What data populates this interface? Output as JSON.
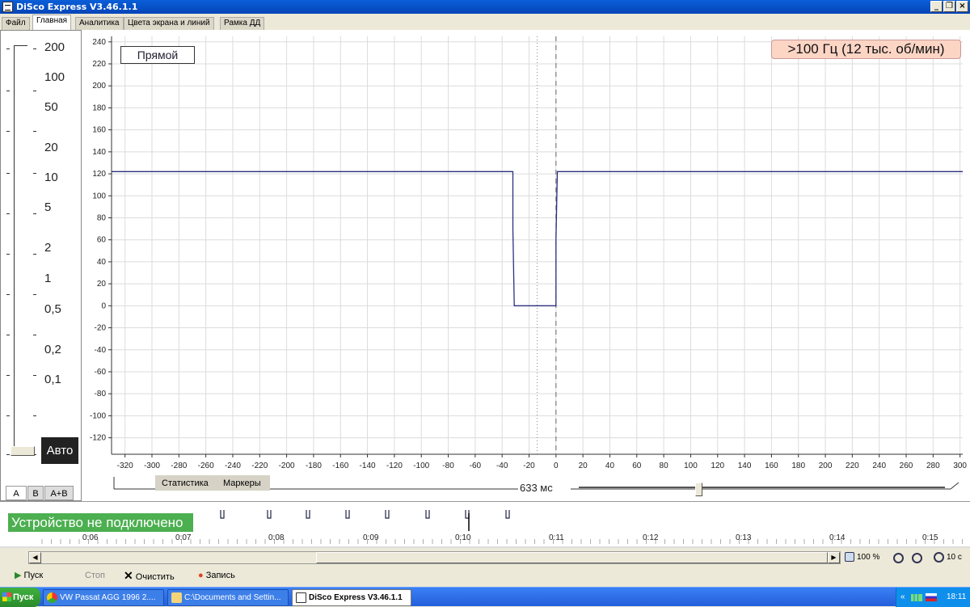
{
  "window": {
    "title": "DiSco Express V3.46.1.1",
    "controls": {
      "minimize": "_",
      "restore": "❐",
      "close": "×"
    }
  },
  "menu_tabs": [
    {
      "label": "Файл",
      "active": false
    },
    {
      "label": "Главная",
      "active": true
    },
    {
      "label": "Аналитика",
      "active": false
    },
    {
      "label": "Цвета экрана и линий",
      "active": false
    },
    {
      "label": "Рамка ДД",
      "active": false
    }
  ],
  "scale_panel": {
    "labels": [
      "200",
      "100",
      "50",
      "20",
      "10",
      "5",
      "2",
      "1",
      "0,5",
      "0,2",
      "0,1"
    ],
    "auto_button": "Авто",
    "channel_tabs": [
      "A",
      "B",
      "A+B"
    ]
  },
  "plot": {
    "mode_label": "Прямой",
    "frequency_label": ">100 Гц (12 тыс. об/мин)",
    "subtabs": [
      "Статистика",
      "Маркеры"
    ],
    "window_label": "633 мс"
  },
  "chart_data": {
    "type": "line",
    "xlim": [
      -330,
      302
    ],
    "ylim": [
      -135,
      245
    ],
    "x_ticks": [
      -320,
      -300,
      -280,
      -260,
      -240,
      -220,
      -200,
      -180,
      -160,
      -140,
      -120,
      -100,
      -80,
      -60,
      -40,
      -20,
      0,
      20,
      40,
      60,
      80,
      100,
      120,
      140,
      160,
      180,
      200,
      220,
      240,
      260,
      280,
      300
    ],
    "y_ticks": [
      240,
      220,
      200,
      180,
      160,
      140,
      120,
      100,
      80,
      60,
      40,
      20,
      0,
      -20,
      -40,
      -60,
      -80,
      -100,
      -120
    ],
    "grid": true,
    "series": [
      {
        "color": "#2b2f80",
        "x": [
          -330,
          -32,
          -32,
          -31,
          -31,
          0,
          0,
          1,
          1,
          302
        ],
        "y": [
          122,
          122,
          70,
          0,
          0,
          0,
          60,
          122,
          122,
          122
        ]
      }
    ],
    "dashed_vline_x": 0,
    "dotted_vline_x": -14
  },
  "timeline": {
    "status": "Устройство не подключено",
    "labels": [
      "0:06",
      "0:07",
      "0:08",
      "0:09",
      "0:10",
      "0:11",
      "0:12",
      "0:13",
      "0:14",
      "0:15"
    ]
  },
  "zoom": {
    "percent": "100 %",
    "time": "10 с"
  },
  "toolbar": {
    "play": "Пуск",
    "stop": "Стоп",
    "clear": "Очистить",
    "record": "Запись"
  },
  "taskbar": {
    "start": "Пуск",
    "tasks": [
      {
        "label": "VW Passat AGG 1996 2....",
        "active": false
      },
      {
        "label": "C:\\Documents and Settin...",
        "active": false
      },
      {
        "label": "DiSco Express V3.46.1.1",
        "active": true
      }
    ],
    "clock": "18:11",
    "tray_arrow": "«"
  },
  "colors": {
    "signal": "#2b2f80",
    "status_ok": "#4caf50",
    "freq_bg": "#fcd5c5"
  }
}
